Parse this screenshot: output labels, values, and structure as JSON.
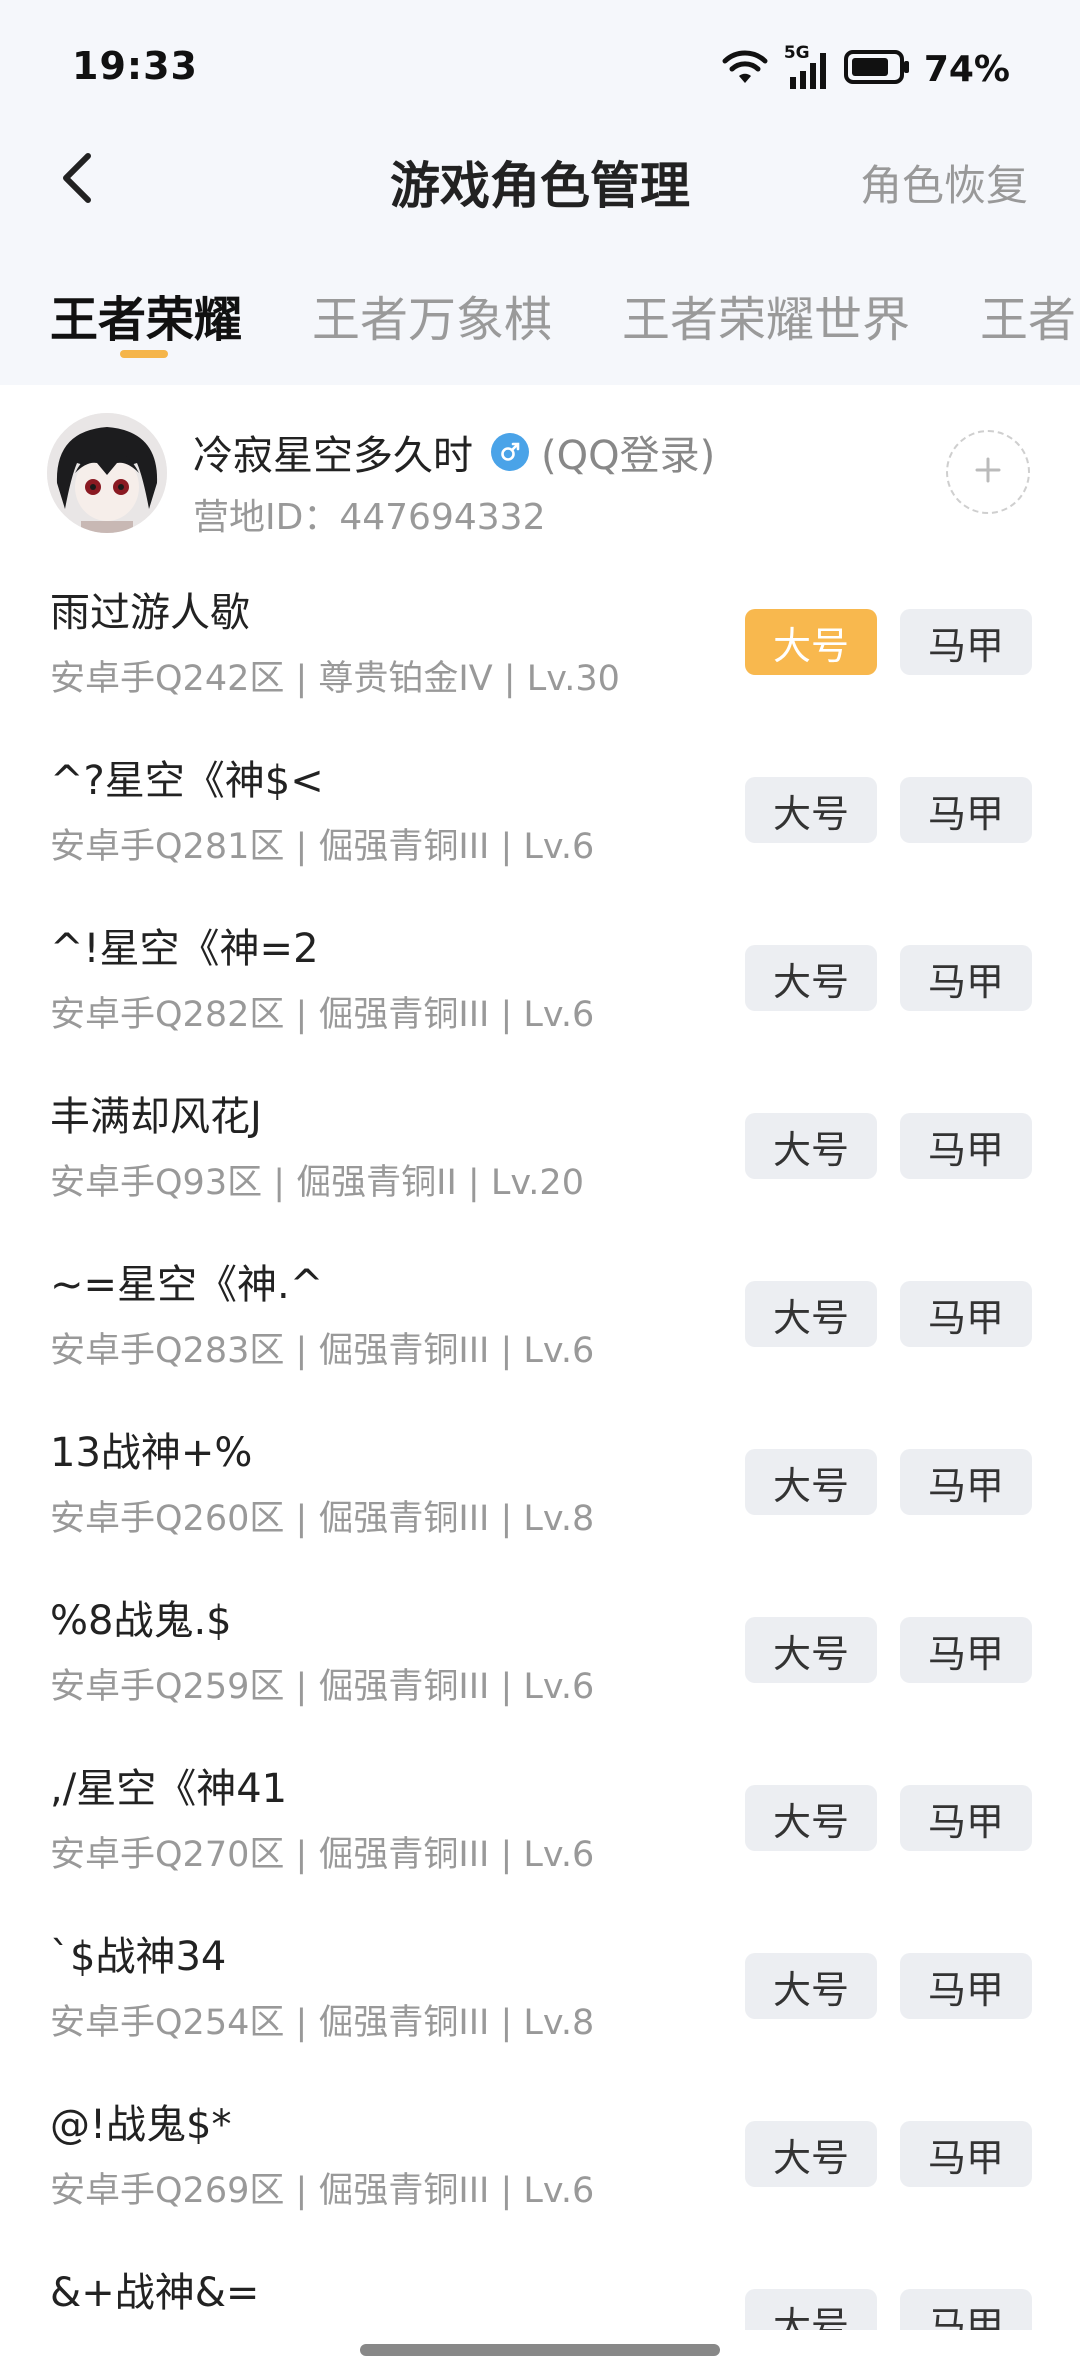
{
  "status_bar": {
    "time": "19:33",
    "network": "5G",
    "battery": "74%"
  },
  "header": {
    "title": "游戏角色管理",
    "restore_label": "角色恢复"
  },
  "tabs": [
    {
      "label": "王者荣耀",
      "active": true
    },
    {
      "label": "王者万象棋",
      "active": false
    },
    {
      "label": "王者荣耀世界",
      "active": false
    },
    {
      "label": "王者",
      "active": false
    }
  ],
  "profile": {
    "name": "冷寂星空多久时",
    "login_type": "(QQ登录)",
    "id_label": "营地ID：",
    "id_value": "447694332"
  },
  "button_labels": {
    "main": "大号",
    "alt": "马甲"
  },
  "roles": [
    {
      "name": "雨过游人歇",
      "meta": "安卓手Q242区 | 尊贵铂金IV | Lv.30",
      "is_main": true
    },
    {
      "name": "^?星空《神$<",
      "meta": "安卓手Q281区 | 倔强青铜III | Lv.6",
      "is_main": false
    },
    {
      "name": "^!星空《神=2",
      "meta": "安卓手Q282区 | 倔强青铜III | Lv.6",
      "is_main": false
    },
    {
      "name": "丰满却风花J",
      "meta": "安卓手Q93区 | 倔强青铜II | Lv.20",
      "is_main": false
    },
    {
      "name": "~=星空《神.^",
      "meta": "安卓手Q283区 | 倔强青铜III | Lv.6",
      "is_main": false
    },
    {
      "name": "13战神+%",
      "meta": "安卓手Q260区 | 倔强青铜III | Lv.8",
      "is_main": false
    },
    {
      "name": "%8战鬼.$",
      "meta": "安卓手Q259区 | 倔强青铜III | Lv.6",
      "is_main": false
    },
    {
      "name": ",/星空《神41",
      "meta": "安卓手Q270区 | 倔强青铜III | Lv.6",
      "is_main": false
    },
    {
      "name": "`$战神34",
      "meta": "安卓手Q254区 | 倔强青铜III | Lv.8",
      "is_main": false
    },
    {
      "name": "@!战鬼$*",
      "meta": "安卓手Q269区 | 倔强青铜III | Lv.6",
      "is_main": false
    },
    {
      "name": "&+战神&=",
      "meta": "",
      "is_main": false
    }
  ],
  "colors": {
    "accent": "#f8b84e",
    "background_top": "#f5f7fb",
    "button_bg": "#eceef2",
    "gender_icon": "#4aa3e8"
  },
  "icons": {
    "back": "chevron-left-icon",
    "wifi": "wifi-icon",
    "signal": "signal-icon",
    "battery": "battery-icon",
    "gender": "male-icon",
    "add": "plus-icon"
  }
}
